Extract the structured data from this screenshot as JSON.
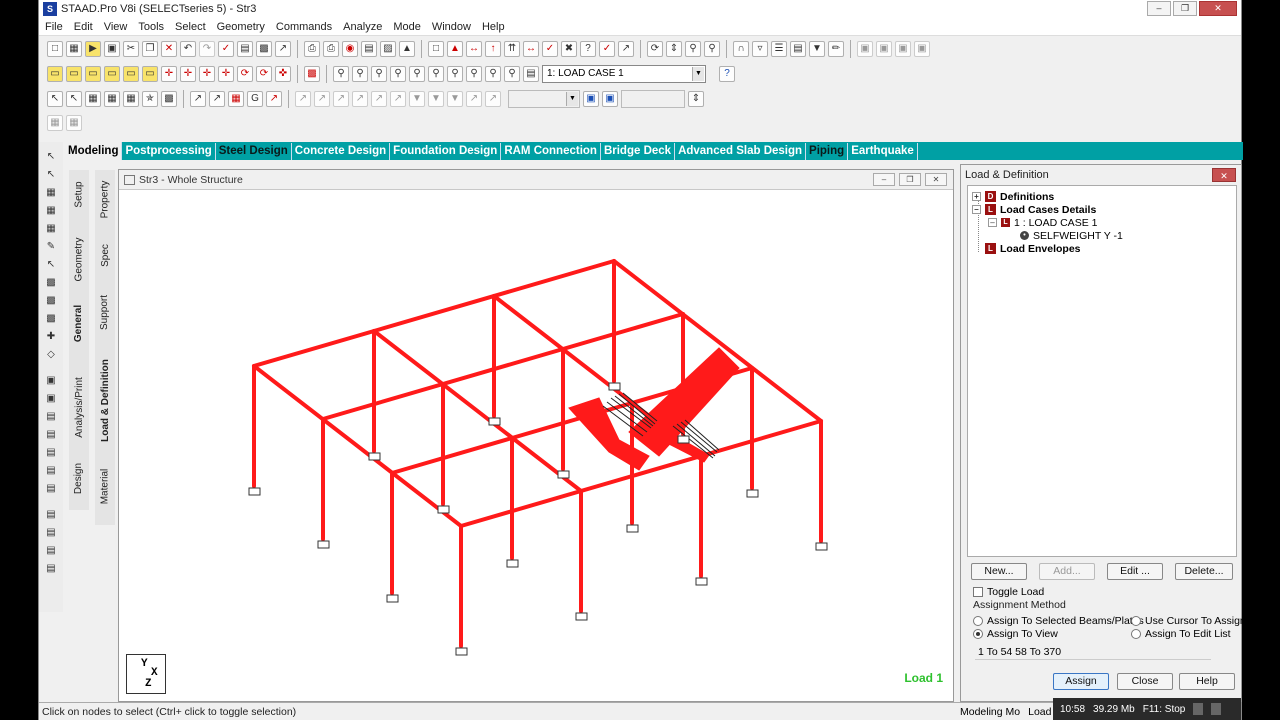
{
  "window": {
    "title": "STAAD.Pro V8i (SELECTseries 5) - Str3"
  },
  "menu": [
    "File",
    "Edit",
    "View",
    "Tools",
    "Select",
    "Geometry",
    "Commands",
    "Analyze",
    "Mode",
    "Window",
    "Help"
  ],
  "toolbar": {
    "load_case_combo": "1: LOAD CASE 1"
  },
  "tabs": [
    "Modeling",
    "Postprocessing",
    "Steel Design",
    "Concrete Design",
    "Foundation Design",
    "RAM Connection",
    "Bridge Deck",
    "Advanced Slab Design",
    "Piping",
    "Earthquake"
  ],
  "active_tab": "Modeling",
  "vtabs_outer": {
    "setup": "Setup",
    "geometry": "Geometry",
    "general": "General",
    "analysis": "Analysis/Print",
    "design": "Design"
  },
  "vtabs_inner": {
    "property": "Property",
    "spec": "Spec",
    "support": "Support",
    "load": "Load & Definition",
    "material": "Material"
  },
  "view": {
    "title": "Str3 - Whole Structure",
    "load_label": "Load 1",
    "axis": {
      "y": "Y",
      "x": "X",
      "z": "Z"
    }
  },
  "panel": {
    "title": "Load & Definition",
    "tree": {
      "definitions": "Definitions",
      "load_cases_details": "Load Cases Details",
      "load_case_1": "1 : LOAD CASE 1",
      "selfweight": "SELFWEIGHT Y -1",
      "load_envelopes": "Load Envelopes"
    },
    "buttons": {
      "new": "New...",
      "add": "Add...",
      "edit": "Edit ...",
      "delete": "Delete...",
      "assign": "Assign",
      "close": "Close",
      "help": "Help"
    },
    "toggle_load": "Toggle Load",
    "assignment_method": "Assignment Method",
    "radio": {
      "selected_beams": "Assign To Selected Beams/Plates",
      "use_cursor": "Use Cursor To Assign",
      "to_view": "Assign To View",
      "to_edit_list": "Assign To Edit List"
    },
    "assign_list": "1 To 54 58 To 370"
  },
  "status": {
    "hint": "Click on nodes to select (Ctrl+ click to toggle selection)",
    "mode": "Modeling Mo",
    "load": "Load"
  },
  "taskbar": {
    "time": "10:58",
    "memory": "39.29 Mb",
    "f11": "F11: Stop"
  },
  "colors": {
    "tab_bar": "#00a0a4",
    "members": "#ff1a1a",
    "load_text": "#2ec12e"
  }
}
